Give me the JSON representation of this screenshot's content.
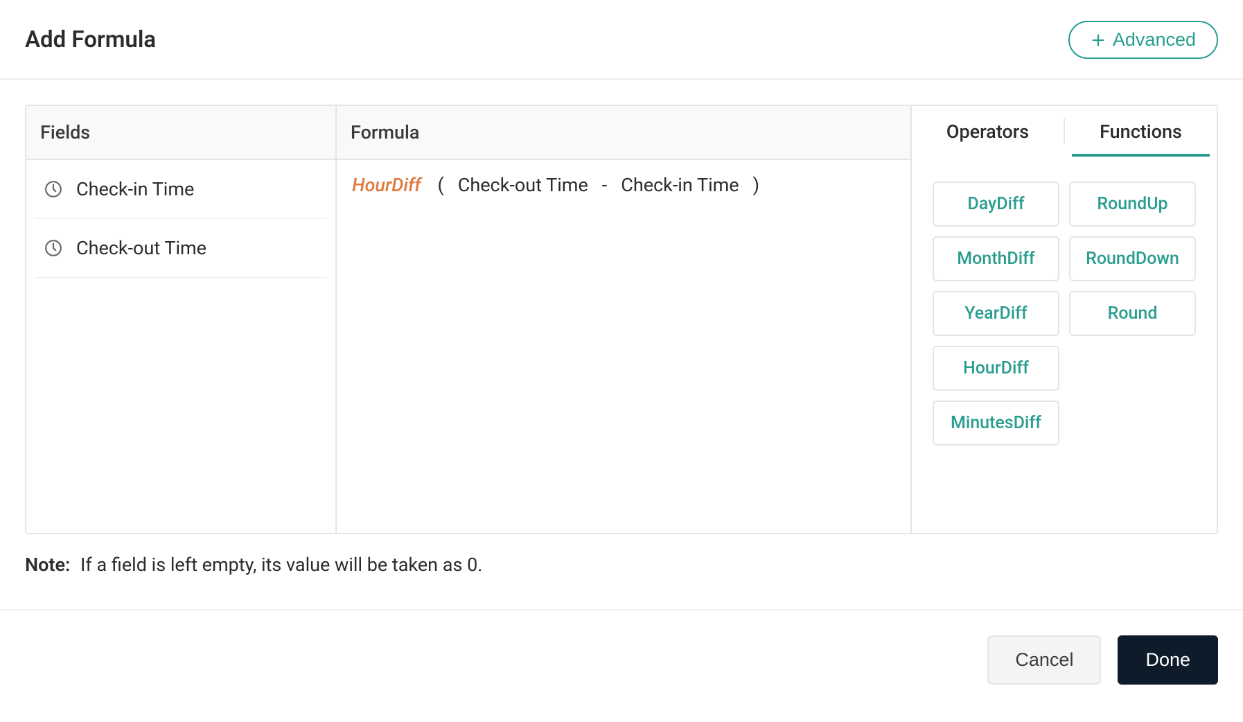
{
  "header": {
    "title": "Add Formula",
    "advanced_label": "Advanced"
  },
  "fields": {
    "header": "Fields",
    "items": [
      {
        "label": "Check-in Time",
        "icon": "clock-icon"
      },
      {
        "label": "Check-out Time",
        "icon": "clock-icon"
      }
    ]
  },
  "formula": {
    "header": "Formula",
    "tokens": {
      "func": "HourDiff",
      "open": "(",
      "field1": "Check-out Time",
      "op": "-",
      "field2": "Check-in Time",
      "close": ")"
    }
  },
  "right": {
    "tabs": {
      "operators": "Operators",
      "functions": "Functions",
      "active": "functions"
    },
    "functions": [
      "DayDiff",
      "RoundUp",
      "MonthDiff",
      "RoundDown",
      "YearDiff",
      "Round",
      "HourDiff",
      "",
      "MinutesDiff",
      ""
    ]
  },
  "note": {
    "label": "Note:",
    "text": "If a field is left empty, its value will be taken as 0."
  },
  "footer": {
    "cancel": "Cancel",
    "done": "Done"
  },
  "colors": {
    "accent": "#2a9d8f",
    "func_text": "#e07a3f",
    "done_bg": "#0d1b2a"
  }
}
